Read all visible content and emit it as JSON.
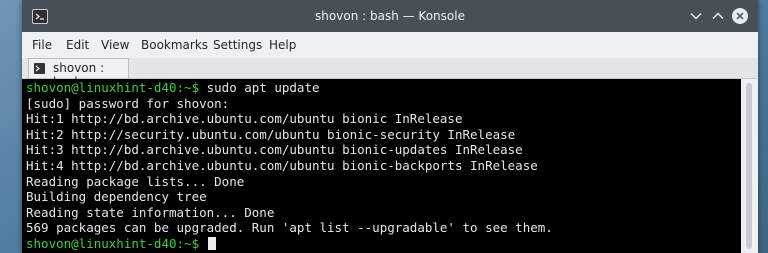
{
  "window": {
    "title": "shovon : bash — Konsole"
  },
  "menubar": {
    "items": [
      "File",
      "Edit",
      "View",
      "Bookmarks",
      "Settings",
      "Help"
    ]
  },
  "tabs": [
    {
      "label": "shovon : bash"
    }
  ],
  "terminal": {
    "prompt": "shovon@linuxhint-d40:~$",
    "command": " sudo apt update",
    "output": [
      "[sudo] password for shovon:",
      "Hit:1 http://bd.archive.ubuntu.com/ubuntu bionic InRelease",
      "Hit:2 http://security.ubuntu.com/ubuntu bionic-security InRelease",
      "Hit:3 http://bd.archive.ubuntu.com/ubuntu bionic-updates InRelease",
      "Hit:4 http://bd.archive.ubuntu.com/ubuntu bionic-backports InRelease",
      "Reading package lists... Done",
      "Building dependency tree",
      "Reading state information... Done",
      "569 packages can be upgraded. Run 'apt list --upgradable' to see them."
    ],
    "final_prompt": "shovon@linuxhint-d40:~$",
    "colors": {
      "prompt": "#3ed13e",
      "text": "#e6e6e6",
      "background": "#000000"
    }
  },
  "icons": {
    "window": "konsole-app-icon",
    "minimize": "chevron-down-icon",
    "maximize": "chevron-up-icon",
    "close": "close-icon",
    "tab": "terminal-tab-icon"
  }
}
